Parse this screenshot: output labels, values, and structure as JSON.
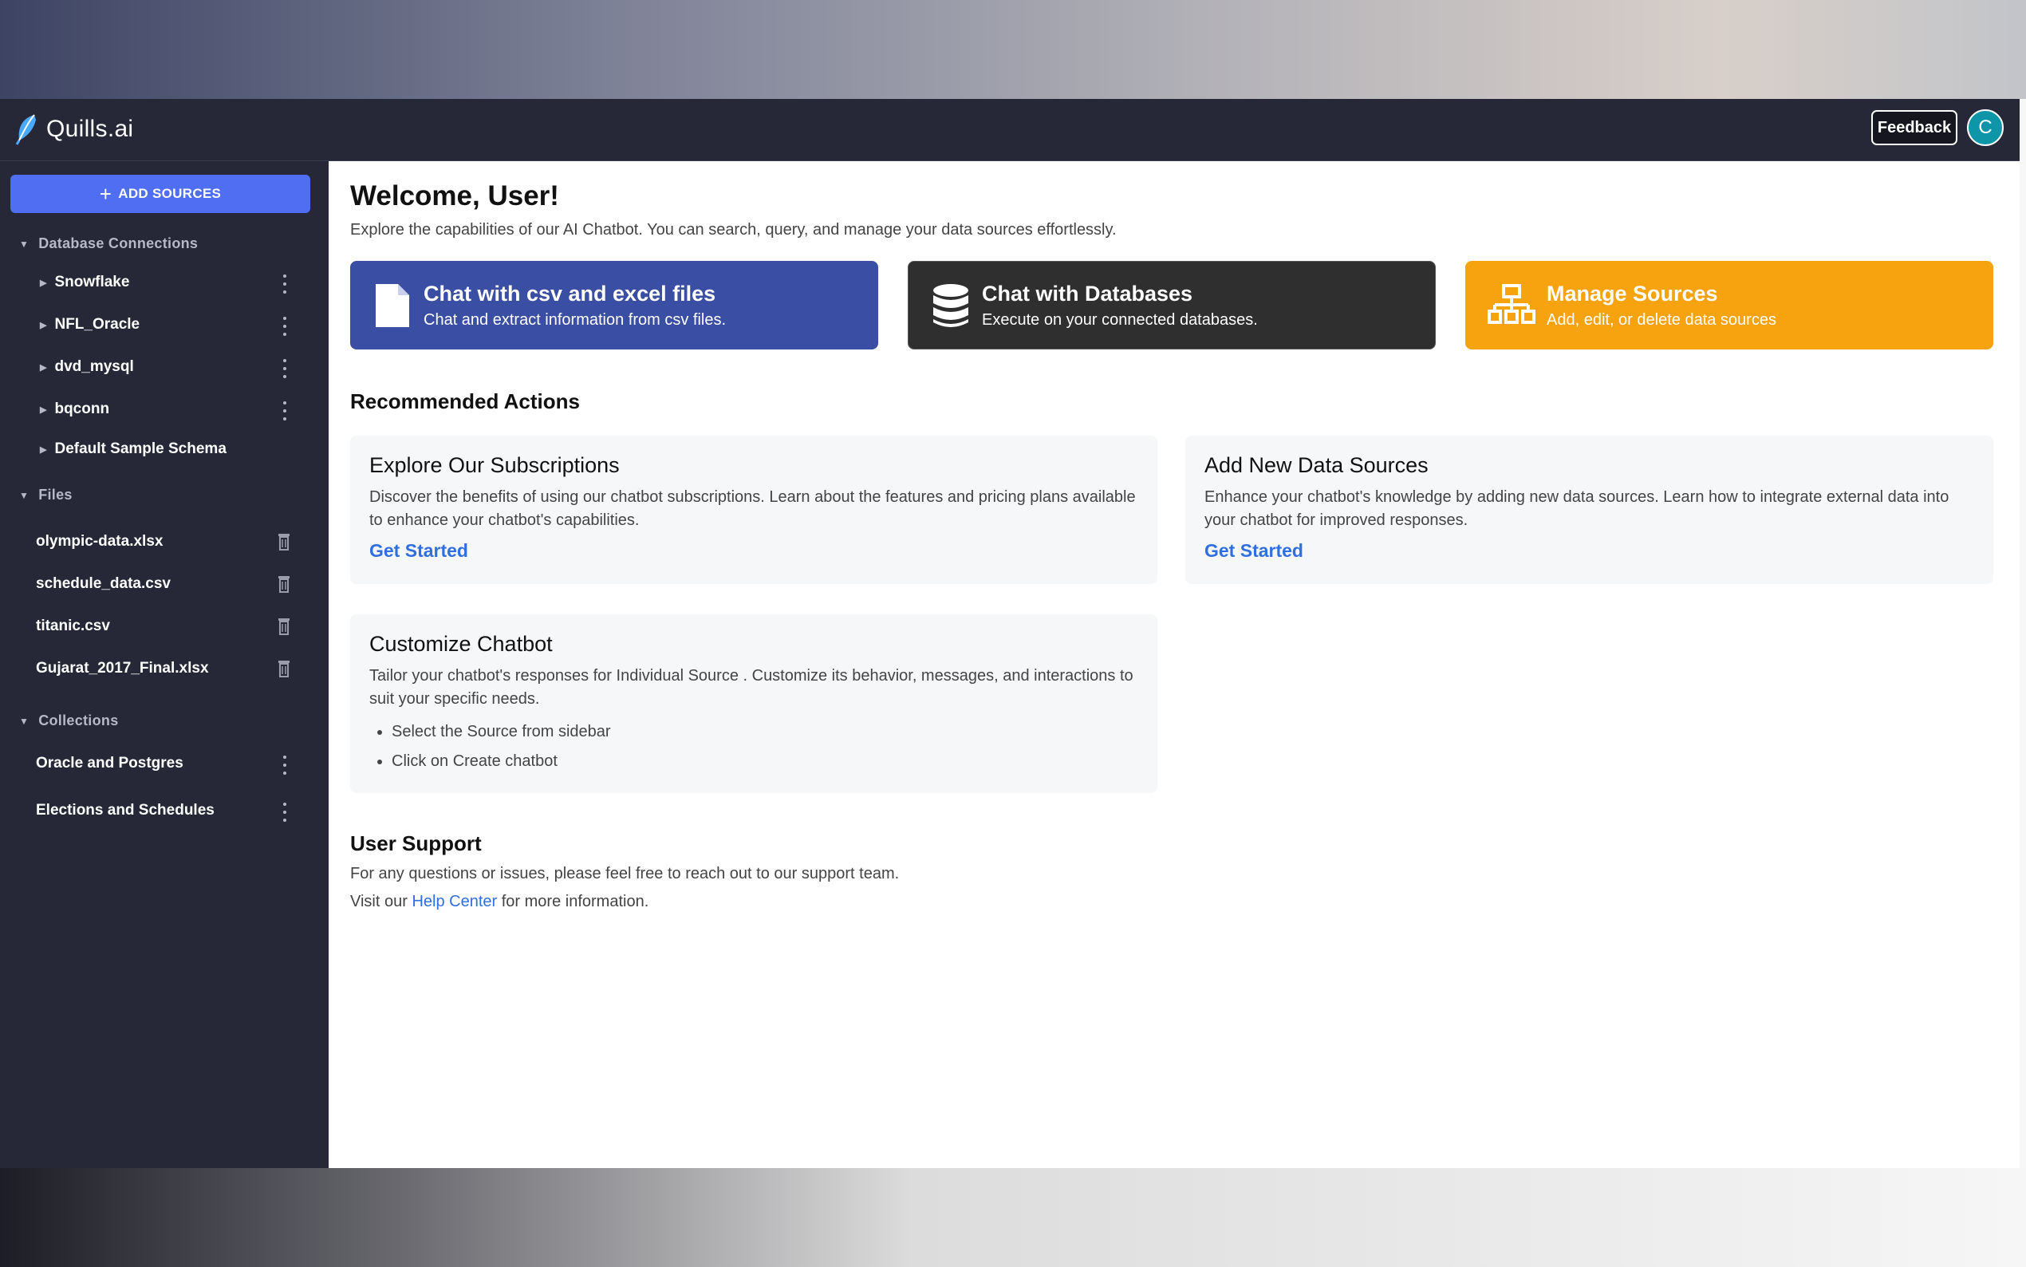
{
  "app": {
    "name": "Quills.ai",
    "feedback_label": "Feedback",
    "avatar_initial": "C"
  },
  "sidebar": {
    "add_sources_label": "ADD SOURCES",
    "database_connections": {
      "header": "Database Connections",
      "items": [
        "Snowflake",
        "NFL_Oracle",
        "dvd_mysql",
        "bqconn",
        "Default Sample Schema"
      ]
    },
    "files": {
      "header": "Files",
      "items": [
        "olympic-data.xlsx",
        "schedule_data.csv",
        "titanic.csv",
        "Gujarat_2017_Final.xlsx"
      ]
    },
    "collections": {
      "header": "Collections",
      "items": [
        "Oracle and Postgres",
        "Elections and Schedules"
      ]
    }
  },
  "main": {
    "welcome_title": "Welcome, User!",
    "welcome_subtitle": "Explore the capabilities of our AI Chatbot. You can search, query, and manage your data sources effortlessly.",
    "quick_actions": [
      {
        "title": "Chat with csv and excel files",
        "description": "Chat and extract information from csv files.",
        "icon": "file-icon",
        "color": "#3a4fa3"
      },
      {
        "title": "Chat with Databases",
        "description": "Execute on your connected databases.",
        "icon": "database-icon",
        "color": "#2f2f2f"
      },
      {
        "title": "Manage Sources",
        "description": "Add, edit, or delete data sources",
        "icon": "sitemap-icon",
        "color": "#f6a30f"
      }
    ],
    "recommended": {
      "title": "Recommended Actions",
      "cards": [
        {
          "title": "Explore Our Subscriptions",
          "description": "Discover the benefits of using our chatbot subscriptions. Learn about the features and pricing plans available to enhance your chatbot's capabilities.",
          "link": "Get Started"
        },
        {
          "title": "Add New Data Sources",
          "description": "Enhance your chatbot's knowledge by adding new data sources. Learn how to integrate external data into your chatbot for improved responses.",
          "link": "Get Started"
        },
        {
          "title": "Customize Chatbot",
          "description": "Tailor your chatbot's responses for Individual Source . Customize its behavior, messages, and interactions to suit your specific needs.",
          "steps": [
            "Select the Source from sidebar",
            "Click on Create chatbot"
          ]
        }
      ]
    },
    "support": {
      "title": "User Support",
      "line1": "For any questions or issues, please feel free to reach out to our support team.",
      "line2_prefix": "Visit our",
      "line2_link": "Help Center",
      "line2_suffix": "for more information."
    }
  }
}
